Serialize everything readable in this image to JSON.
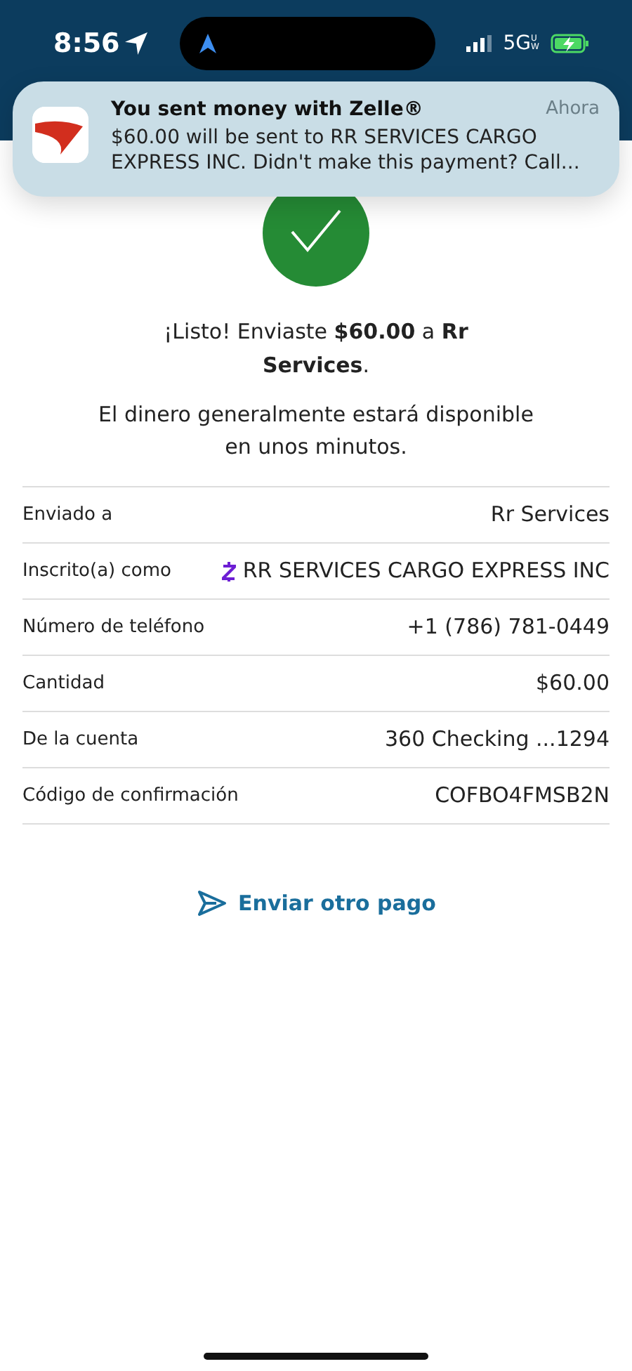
{
  "status_bar": {
    "time": "8:56",
    "network": "5G",
    "network_suffix": "UW"
  },
  "notification": {
    "title": "You sent money with Zelle®",
    "time": "Ahora",
    "body": "$60.00 will be sent to RR SERVICES CARGO EXPRESS INC. Didn't make this payment? Call..."
  },
  "message": "¡Listo! Enviaste **$60.00** a **Rr Services**.",
  "note": "El dinero generalmente estará disponible en unos minutos.",
  "details": [
    {
      "kind": "plain",
      "label": "Enviado a",
      "value": "Rr Services"
    },
    {
      "kind": "zelle",
      "label": "Inscrito(a) como",
      "value": "RR SERVICES CARGO EXPRESS INC"
    },
    {
      "kind": "plain",
      "label": "Número de teléfono",
      "value": "+1 (786) 781-0449"
    },
    {
      "kind": "plain",
      "label": "Cantidad",
      "value": "$60.00"
    },
    {
      "kind": "plain",
      "label": "De la cuenta",
      "value": "360 Checking ...1294"
    },
    {
      "kind": "plain",
      "label": "Código de confirmación",
      "value": "COFBO4FMSB2N"
    }
  ],
  "action": "Enviar otro pago"
}
